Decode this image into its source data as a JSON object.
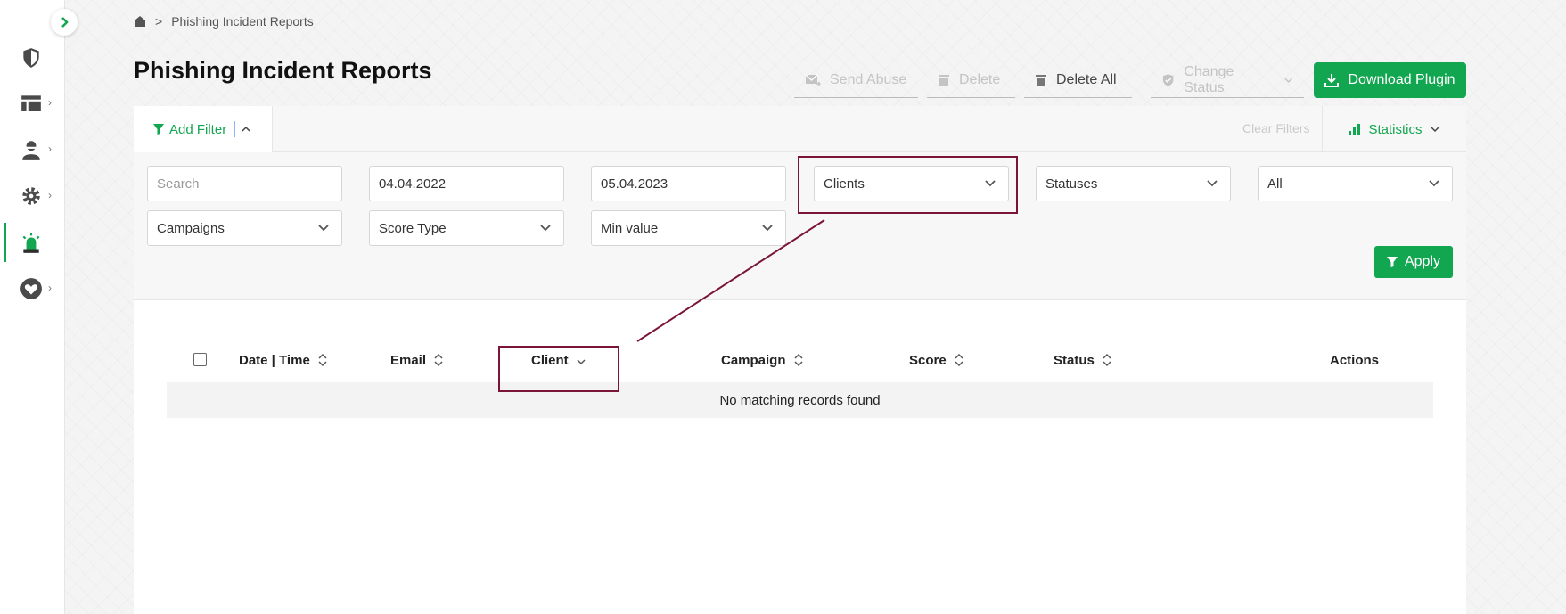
{
  "breadcrumb": {
    "home_icon": "home-icon",
    "separator": ">",
    "current": "Phishing Incident Reports"
  },
  "page": {
    "title": "Phishing Incident Reports"
  },
  "toolbar": {
    "send_abuse": "Send Abuse",
    "delete": "Delete",
    "delete_all": "Delete All",
    "change_status": "Change Status",
    "download_plugin": "Download Plugin"
  },
  "filter_bar": {
    "add_filter": "Add Filter",
    "clear_filters": "Clear Filters",
    "statistics": "Statistics"
  },
  "filters": {
    "search_placeholder": "Search",
    "date_from": "04.04.2022",
    "date_to": "05.04.2023",
    "clients": "Clients",
    "statuses": "Statuses",
    "all": "All",
    "campaigns": "Campaigns",
    "score_type": "Score Type",
    "min_value": "Min value",
    "apply": "Apply"
  },
  "table": {
    "columns": {
      "date_time": "Date | Time",
      "email": "Email",
      "client": "Client",
      "campaign": "Campaign",
      "score": "Score",
      "status": "Status",
      "actions": "Actions"
    },
    "empty_message": "No matching records found"
  },
  "sidebar": {
    "icons": [
      "shield-icon",
      "dashboard-icon",
      "users-icon",
      "settings-icon",
      "alarm-icon",
      "heart-icon"
    ]
  },
  "colors": {
    "accent": "#12a650",
    "annotation": "#7a1535"
  }
}
